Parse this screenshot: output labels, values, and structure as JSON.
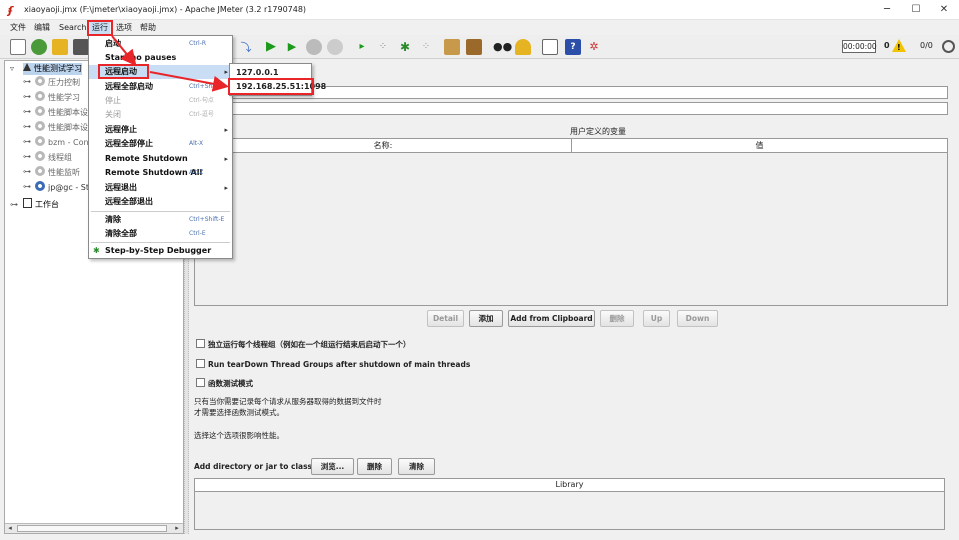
{
  "window": {
    "title": "xiaoyaoji.jmx (F:\\jmeter\\xiaoyaoji.jmx) - Apache JMeter (3.2 r1790748)",
    "minimize": "─",
    "maximize": "☐",
    "close": "✕"
  },
  "menubar": {
    "items": [
      "文件",
      "编辑",
      "Search",
      "运行",
      "选项",
      "帮助"
    ]
  },
  "toolbar": {
    "elapsed": "00:00:00",
    "warn_count": "0",
    "threads": "0/0",
    "icons": [
      "new-icon",
      "templates-icon",
      "open-icon",
      "save-icon",
      "cut-icon",
      "copy-icon",
      "paste-icon",
      "expand-icon",
      "collapse-icon",
      "toggle-icon",
      "start-icon",
      "start-no-pauses-icon",
      "stop-icon",
      "shutdown-icon",
      "remote-start-all-icon",
      "remote-stop-all-icon",
      "remote-shutdown-all-icon",
      "clear-icon",
      "clear-all-icon",
      "search-icon",
      "reset-search-icon",
      "function-helper-icon",
      "help-icon",
      "log-viewer-icon"
    ]
  },
  "tree": {
    "root": "性能测试学习",
    "children": [
      "压力控制",
      "性能学习",
      "性能脚本设",
      "性能脚本设",
      "bzm - Conc",
      "线程组",
      "性能监听",
      "jp@gc - Ste"
    ],
    "workbench": "工作台"
  },
  "run_menu": {
    "items": [
      {
        "label": "启动",
        "shortcut": "Ctrl-R",
        "enabled": true,
        "submenu": false
      },
      {
        "label": "Start no pauses",
        "shortcut": "",
        "enabled": true,
        "submenu": false
      },
      {
        "label": "远程启动",
        "shortcut": "",
        "enabled": true,
        "submenu": true
      },
      {
        "label": "远程全部启动",
        "shortcut": "Ctrl+Shift-R",
        "enabled": true,
        "submenu": false
      },
      {
        "label": "停止",
        "shortcut": "Ctrl-句点",
        "enabled": false,
        "submenu": false
      },
      {
        "label": "关闭",
        "shortcut": "Ctrl-逗号",
        "enabled": false,
        "submenu": false
      },
      {
        "label": "远程停止",
        "shortcut": "",
        "enabled": true,
        "submenu": true
      },
      {
        "label": "远程全部停止",
        "shortcut": "Alt-X",
        "enabled": true,
        "submenu": false
      },
      {
        "label": "Remote Shutdown",
        "shortcut": "",
        "enabled": true,
        "submenu": true
      },
      {
        "label": "Remote Shutdown All",
        "shortcut": "Alt-Z",
        "enabled": true,
        "submenu": false
      },
      {
        "label": "远程退出",
        "shortcut": "",
        "enabled": true,
        "submenu": true
      },
      {
        "label": "远程全部退出",
        "shortcut": "",
        "enabled": true,
        "submenu": false
      },
      {
        "label": "清除",
        "shortcut": "Ctrl+Shift-E",
        "enabled": true,
        "submenu": false
      },
      {
        "label": "清除全部",
        "shortcut": "Ctrl-E",
        "enabled": true,
        "submenu": false
      },
      {
        "label": "Step-by-Step Debugger",
        "shortcut": "",
        "enabled": true,
        "submenu": false
      }
    ]
  },
  "remote_submenu": {
    "items": [
      "127.0.0.1",
      "192.168.25.51:1098"
    ]
  },
  "test_plan": {
    "vars_title": "用户定义的变量",
    "col_name": "名称:",
    "col_value": "值",
    "buttons": {
      "detail": "Detail",
      "add": "添加",
      "add_clipboard": "Add from Clipboard",
      "delete": "删除",
      "up": "Up",
      "down": "Down"
    },
    "checkboxes": [
      "独立运行每个线程组（例如在一个组运行结束后启动下一个）",
      "Run tearDown Thread Groups after shutdown of main threads",
      "函数测试模式"
    ],
    "notes": [
      "只有当你需要记录每个请求从服务器取得的数据到文件时",
      "才需要选择函数测试模式。",
      "选择这个选项很影响性能。"
    ],
    "classpath_label": "Add directory or jar to classpath",
    "classpath_buttons": {
      "browse": "浏览...",
      "delete": "删除",
      "clear": "清除"
    },
    "library_header": "Library"
  },
  "colors": {
    "highlight": "#e8262a",
    "menu_hover": "#c9def5"
  }
}
